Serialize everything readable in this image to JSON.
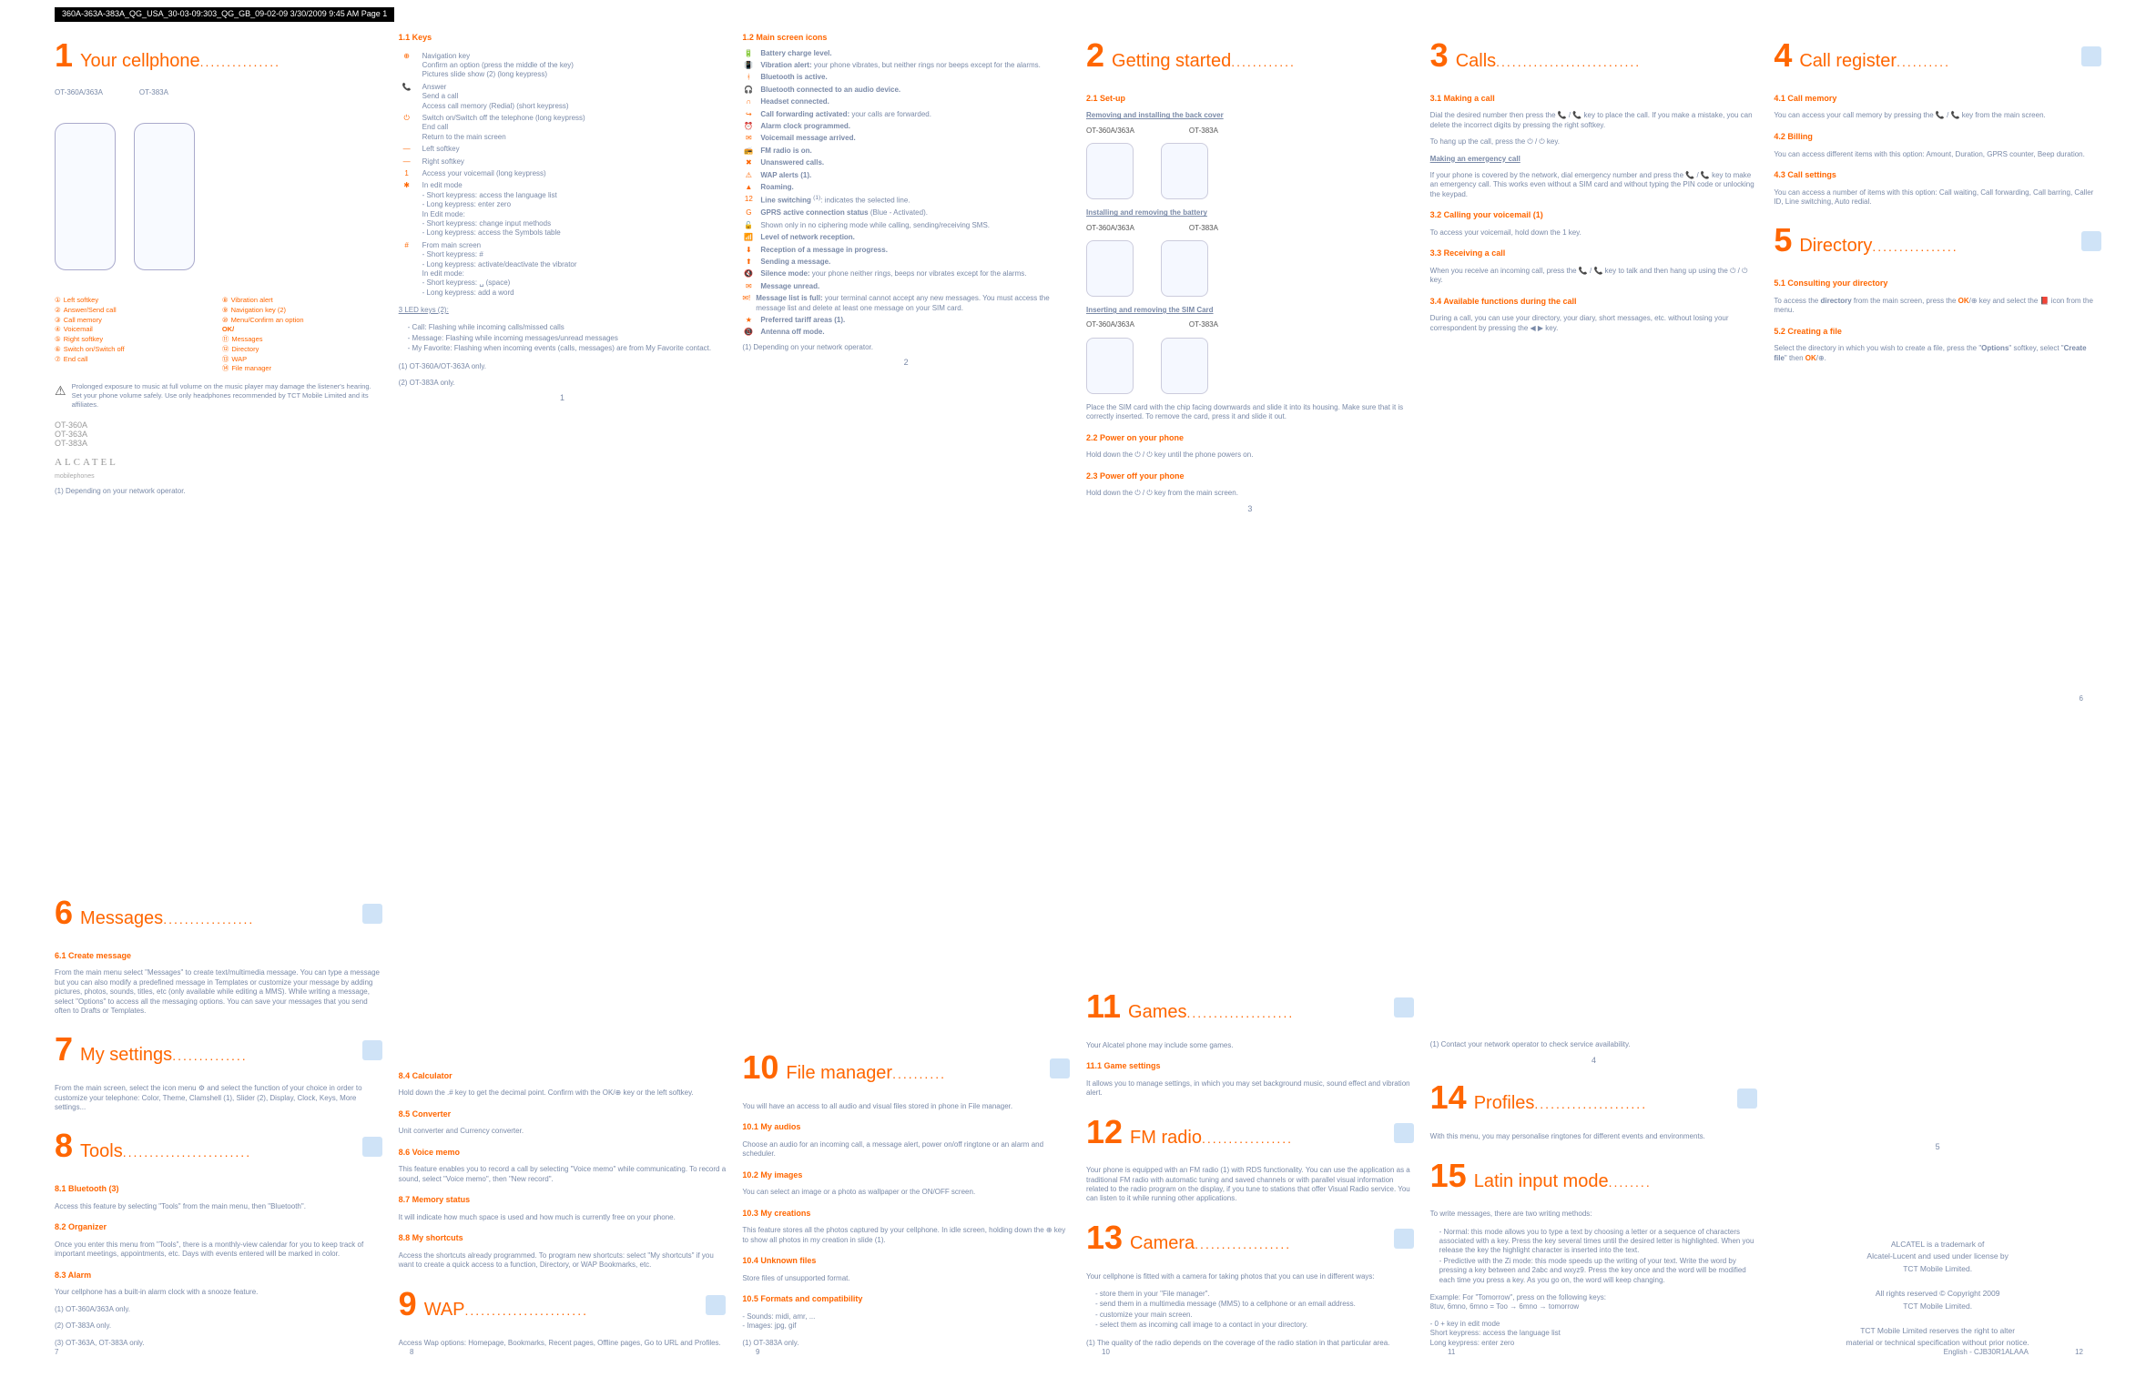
{
  "header": "360A-363A-383A_QG_USA_30-03-09:303_QG_GB_09-02-09  3/30/2009  9:45 AM  Page 1",
  "models": "OT-360A\nOT-363A\nOT-383A",
  "brand": "ALCATEL",
  "brand2": "mobilephones",
  "s1": {
    "title": "Your cellphone",
    "m1": "OT-360A/363A",
    "m2": "OT-383A",
    "legend": [
      "Left softkey",
      "Vibration alert",
      "Answer/Send call",
      "Navigation key (2)",
      "Call memory",
      "Menu/Confirm an option",
      "Voicemail",
      "OK/",
      "Right softkey",
      "Messages",
      "Switch on/Switch off",
      "Directory",
      "End call",
      "WAP",
      "",
      "File manager"
    ],
    "warn": "Prolonged exposure to music at full volume on the music player may damage the listener's hearing. Set your phone volume safely. Use only headphones recommended by TCT Mobile Limited and its affiliates.",
    "note": "(1)  Depending on your network operator."
  },
  "s1b": {
    "h": "1.1   Keys",
    "items": [
      {
        "k": "⊕",
        "t": "Navigation key\nConfirm an option (press the middle of the key)\nPictures slide show (2) (long keypress)"
      },
      {
        "k": "📞",
        "t": "Answer\nSend a call\nAccess call memory (Redial) (short keypress)"
      },
      {
        "k": "⏻",
        "t": "Switch on/Switch off the telephone (long keypress)\nEnd call\nReturn to the main screen"
      },
      {
        "k": "—",
        "t": "Left softkey"
      },
      {
        "k": "—",
        "t": "Right softkey"
      },
      {
        "k": "1",
        "t": "Access your voicemail (long keypress)"
      },
      {
        "k": "✱",
        "t": "In edit mode\n- Short keypress: access the language list\n- Long keypress: enter zero\nIn Edit mode:\n- Short keypress: change input methods\n- Long keypress: access the Symbols table"
      },
      {
        "k": "#",
        "t": "From main screen\n- Short keypress: #\n- Long keypress: activate/deactivate the vibrator\nIn edit mode:\n- Short keypress: ␣ (space)\n- Long keypress: add a word"
      }
    ],
    "led": "3 LED keys (2):",
    "leds": [
      "Call: Flashing while incoming calls/missed calls",
      "Message: Flashing while incoming messages/unread messages",
      "My Favorite: Flashing when incoming events (calls, messages) are from My Favorite contact."
    ],
    "fn": [
      "(1)  OT-360A/OT-363A only.",
      "(2)  OT-383A only."
    ]
  },
  "s1c": {
    "h": "1.2   Main screen icons",
    "items": [
      [
        "🔋",
        "Battery charge level."
      ],
      [
        "📳",
        "Vibration alert: your phone vibrates, but neither rings nor beeps except for the alarms."
      ],
      [
        "ᚼ",
        "Bluetooth is active."
      ],
      [
        "🎧",
        "Bluetooth connected to an audio device."
      ],
      [
        "∩",
        "Headset connected."
      ],
      [
        "↪",
        "Call forwarding activated: your calls are forwarded."
      ],
      [
        "⏰",
        "Alarm clock programmed."
      ],
      [
        "✉",
        "Voicemail message arrived."
      ],
      [
        "📻",
        "FM radio is on."
      ],
      [
        "✖",
        "Unanswered calls."
      ],
      [
        "⚠",
        "WAP alerts (1)."
      ],
      [
        "▲",
        "Roaming."
      ],
      [
        "12",
        "Line switching (1): indicates the selected line."
      ],
      [
        "G",
        "GPRS active connection status (Blue - Activated)."
      ],
      [
        "🔓",
        "Shown only in no ciphering mode while calling, sending/receiving SMS."
      ],
      [
        "📶",
        "Level of network reception."
      ],
      [
        "⬇",
        "Reception of a message in progress."
      ],
      [
        "⬆",
        "Sending a message."
      ],
      [
        "🔇",
        "Silence mode: your phone neither rings, beeps nor vibrates except for the alarms."
      ],
      [
        "✉",
        "Message unread."
      ],
      [
        "✉!",
        "Message list is full: your terminal cannot accept any new messages. You must access the message list and delete at least one message on your SIM card."
      ],
      [
        "★",
        "Preferred tariff areas (1)."
      ],
      [
        "📵",
        "Antenna off mode."
      ]
    ],
    "fn": "(1)  Depending on your network operator."
  },
  "s2": {
    "title": "Getting started",
    "h1": "2.1   Set-up",
    "l1": "Removing and installing the back cover",
    "m1": "OT-360A/363A",
    "m2": "OT-383A",
    "l2": "Installing and removing the battery",
    "l3": "Inserting and removing the SIM Card",
    "t1": "Place the SIM card with the chip facing downwards and slide it into its housing. Make sure that it is correctly inserted. To remove the card, press it and slide it out.",
    "h2": "2.2   Power on your phone",
    "t2": "Hold down the ⏻ / ⏻ key until the phone powers on.",
    "h3": "2.3   Power off your phone",
    "t3": "Hold down the ⏻ / ⏻ key from the main screen."
  },
  "s3": {
    "title": "Calls",
    "h1": "3.1   Making a call",
    "t1": "Dial the desired number then press the 📞 / 📞 key to place the call. If you make a mistake, you can delete the incorrect digits by pressing the right softkey.",
    "t1b": "To hang up the call, press the ⏻ / ⏻ key.",
    "l1": "Making an emergency call",
    "t2": "If your phone is covered by the network, dial emergency number and press the 📞 / 📞 key to make an emergency call. This works even without a SIM card and without typing the PIN code or unlocking the keypad.",
    "h2": "3.2   Calling your voicemail (1)",
    "t3": "To access your voicemail, hold down the 1 key.",
    "h3": "3.3   Receiving a call",
    "t4": "When you receive an incoming call, press the 📞 / 📞 key to talk and then hang up using the ⏻ / ⏻ key.",
    "h4": "3.4   Available functions during the call",
    "t5": "During a call, you can use your directory, your diary, short messages, etc. without losing your correspondent by pressing the ◀ ▶ key.",
    "fn": "(1)  Contact your network operator to check service availability."
  },
  "s4": {
    "title": "Call register",
    "h1": "4.1   Call memory",
    "t1": "You can access your call memory by pressing the 📞 / 📞 key from the main screen.",
    "h2": "4.2   Billing",
    "t2": "You can access different items with this option: Amount, Duration, GPRS counter, Beep duration.",
    "h3": "4.3   Call settings",
    "t3": "You can access a number of items with this option: Call waiting, Call forwarding, Call barring, Caller ID, Line switching, Auto redial."
  },
  "s5": {
    "title": "Directory",
    "h1": "5.1   Consulting your directory",
    "t1": "To access the directory from the main screen, press the OK/⊕ key and select the 📕 icon from the menu.",
    "h2": "5.2   Creating a file",
    "t2": "Select the directory in which you wish to create a file, press the \"Options\" softkey, select \"Create file\" then OK/⊕."
  },
  "s6": {
    "title": "Messages",
    "h1": "6.1   Create message",
    "t1": "From the main menu select \"Messages\" to create text/multimedia message. You can type a message but you can also modify a predefined message in Templates or customize your message by adding pictures, photos, sounds, titles, etc (only available while editing a MMS). While writing a message, select \"Options\" to access all the messaging options. You can save your messages that you send often to Drafts or Templates."
  },
  "s7": {
    "title": "My settings",
    "t1": "From the main screen, select the icon menu ⚙ and select the function of your choice in order to customize your telephone: Color, Theme, Clamshell (1), Slider (2), Display, Clock, Keys, More settings..."
  },
  "s8": {
    "title": "Tools",
    "h1": "8.1   Bluetooth (3)",
    "t1": "Access this feature by selecting \"Tools\" from the main menu, then \"Bluetooth\".",
    "h2": "8.2   Organizer",
    "t2": "Once you enter this menu from \"Tools\", there is a monthly-view calendar for you to keep track of important meetings, appointments, etc. Days with events entered will be marked in color.",
    "h3": "8.3   Alarm",
    "t3": "Your cellphone has a built-in alarm clock with a snooze feature.",
    "h4": "8.4   Calculator",
    "t4": "Hold down the .# key to get the decimal point. Confirm with the OK/⊕ key or the left softkey.",
    "h5": "8.5   Converter",
    "t5": "Unit converter and Currency converter.",
    "h6": "8.6   Voice memo",
    "t6": "This feature enables you to record a call by selecting \"Voice memo\" while communicating. To record a sound, select \"Voice memo\", then \"New record\".",
    "h7": "8.7   Memory status",
    "t7": "It will indicate how much space is used and how much is currently free on your phone.",
    "h8": "8.8   My shortcuts",
    "t8": "Access the shortcuts already programmed. To program new shortcuts: select \"My shortcuts\" if you want to create a quick access to a function, Directory, or WAP Bookmarks, etc.",
    "fn": [
      "(1)  OT-360A/363A only.",
      "(2)  OT-383A only.",
      "(3)  OT-363A, OT-383A only."
    ]
  },
  "s9": {
    "title": "WAP",
    "t1": "Access Wap options: Homepage, Bookmarks, Recent pages, Offline pages, Go to URL and Profiles."
  },
  "s10": {
    "title": "File manager",
    "t0": "You will have an access to all audio and visual files stored in phone in File manager.",
    "h1": "10.1   My audios",
    "t1": "Choose an audio for an incoming call, a message alert, power on/off ringtone or an alarm and scheduler.",
    "h2": "10.2   My images",
    "t2": "You can select an image or a photo as wallpaper or the ON/OFF screen.",
    "h3": "10.3   My creations",
    "t3": "This feature stores all the photos captured by your cellphone. In idle screen, holding down the ⊕ key to show all photos in my creation in slide (1).",
    "h4": "10.4   Unknown files",
    "t4": "Store files of unsupported format.",
    "h5": "10.5   Formats and compatibility",
    "t5": "- Sounds: midi, amr, ...\n- Images: jpg, gif",
    "fn": "(1)  OT-383A only."
  },
  "s11": {
    "title": "Games",
    "t0": "Your Alcatel phone may include some games.",
    "h1": "11.1   Game settings",
    "t1": "It allows you to manage settings, in which you may set background music, sound effect and vibration alert."
  },
  "s12": {
    "title": "FM radio",
    "t1": "Your phone is equipped with an FM radio (1) with RDS functionality. You can use the application as a traditional FM radio with automatic tuning and saved channels or with parallel visual information related to the radio program on the display, if you tune to stations that offer Visual Radio service. You can listen to it while running other applications.",
    "fn": "(1)  The quality of the radio depends on the coverage of the radio station in that particular area."
  },
  "s13": {
    "title": "Camera",
    "t1": "Your cellphone is fitted with a camera for taking photos that you can use in different ways:",
    "items": [
      "store them in your \"File manager\".",
      "send them in a multimedia message (MMS) to a cellphone or an email address.",
      "customize your main screen.",
      "select them as incoming call image to a contact in your directory."
    ]
  },
  "s14": {
    "title": "Profiles",
    "t1": "With this menu, you may personalise ringtones for different events and environments."
  },
  "s15": {
    "title": "Latin input mode",
    "t1": "To write messages, there are two writing methods:",
    "items": [
      "Normal: this mode allows you to type a text by choosing a letter or a sequence of characters associated with a key. Press the key several times until the desired letter is highlighted. When you release the key the highlight character is inserted into the text.",
      "Predictive with the Zi mode: this mode speeds up the writing of your text. Write the word by pressing a key between and 2abc and wxyz9. Press the key once and the word will be modified each time you press a key. As you go on, the word will keep changing."
    ],
    "ex": "Example: For \"Tomorrow\", press on the following keys:\n8tuv, 6mno, 6mno = Too → 6mno → tomorrow",
    "t2": "- 0 + key in edit mode\nShort keypress: access the language list\nLong keypress: enter zero"
  },
  "copyright": [
    "ALCATEL is a trademark of",
    "Alcatel-Lucent and used under license by",
    "TCT Mobile Limited.",
    "",
    "All rights reserved © Copyright 2009",
    "TCT Mobile Limited.",
    "",
    "TCT Mobile Limited reserves the right to alter",
    "material or technical specification without prior notice."
  ],
  "footer_r": "English - CJB30R1ALAAA",
  "pages": [
    "1",
    "2",
    "3",
    "4",
    "5",
    "6",
    "7",
    "8",
    "9",
    "10",
    "11",
    "12"
  ]
}
